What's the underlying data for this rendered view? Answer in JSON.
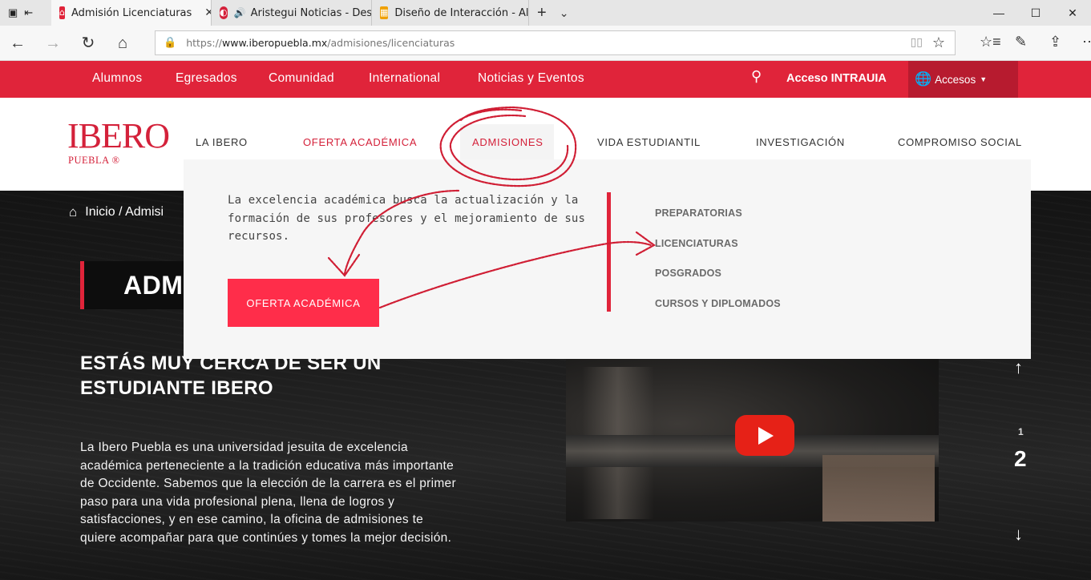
{
  "browser": {
    "tabs": [
      {
        "title": "Admisión Licenciaturas",
        "close": "✕"
      },
      {
        "title": "Aristegui Noticias - Des",
        "close": ""
      },
      {
        "title": "Diseño de Interacción - All I",
        "close": ""
      }
    ],
    "url_prefix": "https://",
    "url_host": "www.iberopuebla.mx",
    "url_path": "/admisiones/licenciaturas"
  },
  "topbar": {
    "links": [
      "Alumnos",
      "Egresados",
      "Comunidad",
      "International",
      "Noticias y Eventos"
    ],
    "intrauia": "Acceso INTRAUIA",
    "accesos": "Accesos"
  },
  "header": {
    "logo": "IBERO",
    "logo_sub": "PUEBLA ®",
    "nav": [
      "LA IBERO",
      "OFERTA ACADÉMICA",
      "ADMISIONES",
      "VIDA ESTUDIANTIL",
      "INVESTIGACIÓN",
      "COMPROMISO SOCIAL"
    ]
  },
  "dropdown": {
    "text": "La excelencia académica busca la actualización y la formación de sus profesores y el mejoramiento de sus recursos.",
    "button": "OFERTA ACADÉMICA",
    "links": [
      "PREPARATORIAS",
      "LICENCIATURAS",
      "POSGRADOS",
      "CURSOS Y DIPLOMADOS"
    ]
  },
  "hero": {
    "breadcrumb": "Inicio / Admisi",
    "title": "ADM",
    "heading": "ESTÁS MUY CERCA DE SER UN ESTUDIANTE IBERO",
    "paragraph": "La Ibero Puebla es una universidad jesuita de excelencia académica perteneciente a la tradición educativa más importante de Occidente. Sabemos que la elección de la carrera es el primer paso para una vida profesional plena, llena de logros y satisfacciones, y en ese camino, la oficina de admisiones te quiere acompañar para que continúes y tomes la mejor decisión.",
    "pager_small": "1",
    "pager_big": "2"
  },
  "colors": {
    "brand_red": "#e0243a",
    "button_red": "#ff2d4a",
    "dark_red": "#b71b2f"
  }
}
